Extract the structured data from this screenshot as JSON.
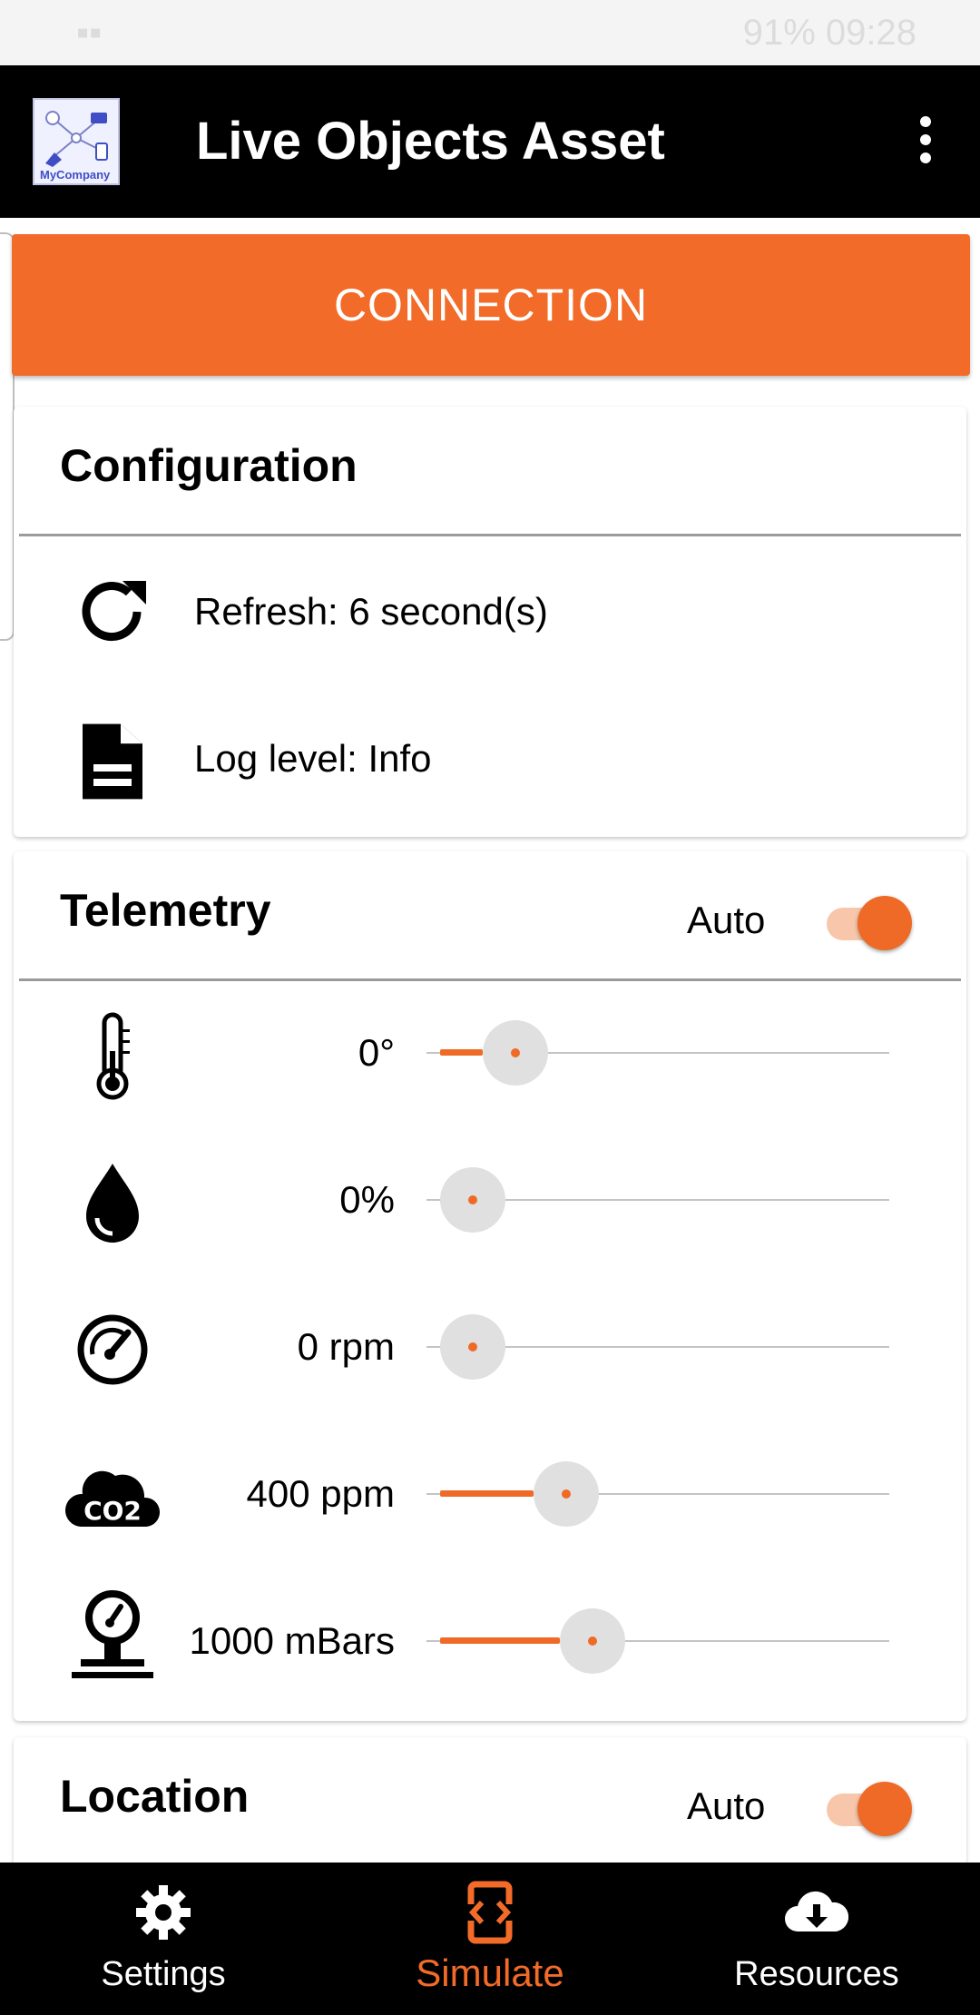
{
  "status_bar": {
    "battery": "91%",
    "time": "09:28"
  },
  "app_bar": {
    "title": "Live Objects Asset",
    "logo_text": "MyCompany",
    "menu_icon": "more-vert-icon"
  },
  "connection": {
    "label": "CONNECTION",
    "color": "#f26b28"
  },
  "configuration": {
    "title": "Configuration",
    "items": [
      {
        "icon": "refresh-icon",
        "label": "Refresh: 6 second(s)"
      },
      {
        "icon": "document-icon",
        "label": "Log level: Info"
      }
    ]
  },
  "telemetry": {
    "title": "Telemetry",
    "auto_label": "Auto",
    "auto_on": true,
    "rows": [
      {
        "icon": "thermometer-icon",
        "value_label": "0°",
        "level": 0.1
      },
      {
        "icon": "water-drop-icon",
        "value_label": "0%",
        "level": 0.0
      },
      {
        "icon": "speedometer-icon",
        "value_label": "0 rpm",
        "level": 0.0
      },
      {
        "icon": "co2-cloud-icon",
        "value_label": "400 ppm",
        "level": 0.22
      },
      {
        "icon": "barometer-icon",
        "value_label": "1000 mBars",
        "level": 0.28
      }
    ]
  },
  "location": {
    "title": "Location",
    "auto_label": "Auto",
    "auto_on": true
  },
  "bottom_nav": [
    {
      "icon": "gear-icon",
      "label": "Settings",
      "active": false
    },
    {
      "icon": "simulate-icon",
      "label": "Simulate",
      "active": true
    },
    {
      "icon": "cloud-download-icon",
      "label": "Resources",
      "active": false
    }
  ],
  "accent_color": "#ef6a26"
}
